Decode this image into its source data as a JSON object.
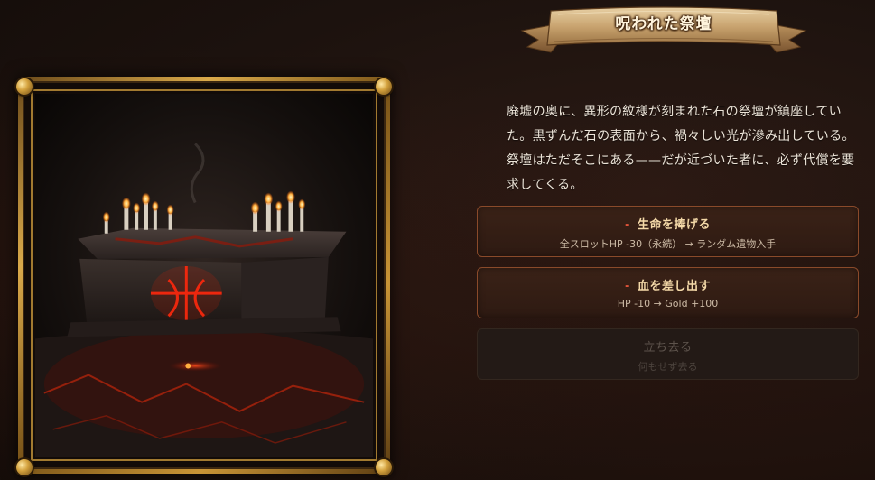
{
  "event": {
    "title": "呪われた祭壇",
    "description": "廃墟の奥に、異形の紋様が刻まれた石の祭壇が鎮座していた。黒ずんだ石の表面から、禍々しい光が滲み出している。祭壇はただそこにある——だが近づいた者に、必ず代償を要求してくる。"
  },
  "choices": [
    {
      "marker": "-",
      "label": "生命を捧げる",
      "effect": "全スロットHP -30（永続） → ランダム遺物入手",
      "enabled": true
    },
    {
      "marker": "-",
      "label": "血を差し出す",
      "effect": "HP -10 → Gold +100",
      "enabled": true
    },
    {
      "label": "立ち去る",
      "effect": "何もせず去る",
      "enabled": false
    }
  ],
  "colors": {
    "accent_red": "#e0533a",
    "gold_frame": "#d9a94a",
    "choice_border": "#8a4a2a",
    "text_light": "#ece4d8"
  },
  "icons": {
    "frame_corners": "gold-rivet-icon"
  }
}
